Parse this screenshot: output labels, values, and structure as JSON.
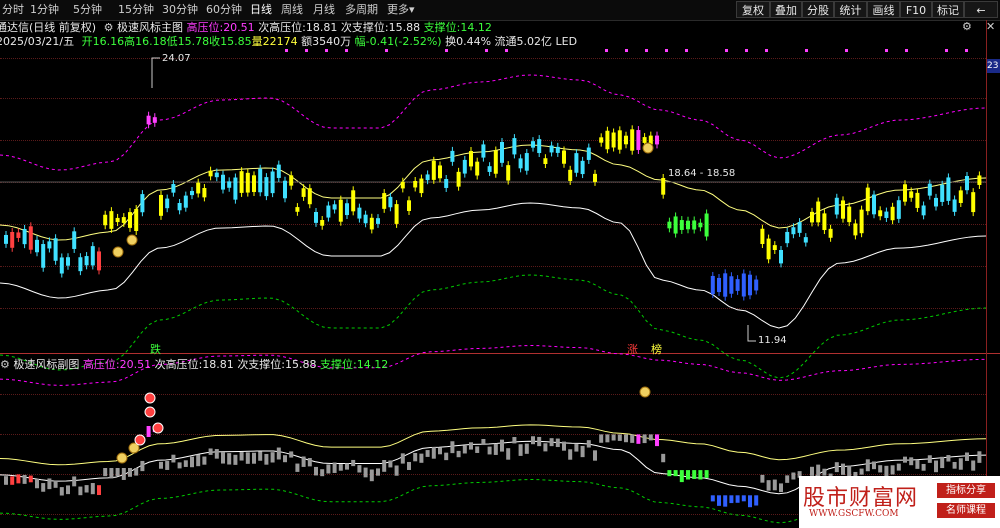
{
  "toolbar": {
    "timeframes": [
      "分时",
      "1分钟",
      "5分钟",
      "15分钟",
      "30分钟",
      "60分钟",
      "日线",
      "周线",
      "月线",
      "多周期",
      "更多"
    ],
    "active_timeframe": "日线",
    "right_buttons": [
      "复权",
      "叠加",
      "分股",
      "统计",
      "画线",
      "F10",
      "标记",
      "←"
    ]
  },
  "main_title": {
    "app": "通达信(日线 前复权)",
    "indicator": "极速风标主图",
    "high_pressure_label": "高压位:",
    "high_pressure_value": "20.51",
    "second_pressure_label": "次高压位:",
    "second_pressure_value": "18.81",
    "second_support_label": "次支撑位:",
    "second_support_value": "15.88",
    "support_label": "支撑位:",
    "support_value": "14.12"
  },
  "quote": {
    "date": "2025/03/21/五",
    "open": "开16.16",
    "high": "高16.18",
    "low": "低15.78",
    "close": "收15.85",
    "volume": "量22174",
    "amount": "额3540万",
    "change": "幅-0.41(-2.52%)",
    "turnover": "换0.44%",
    "float": "流通5.02亿",
    "led": "LED"
  },
  "annotations": {
    "high_mark": "24.07",
    "range_mark": "18.64 - 18.58",
    "low_mark": "11.94",
    "label_die": "跌",
    "label_zhang": "涨",
    "label_bang": "榜",
    "axis_price": "23"
  },
  "sub_title": {
    "indicator": "极速风标副图",
    "high_pressure_label": "高压位:",
    "high_pressure_value": "20.51",
    "second_pressure_label": "次高压位:",
    "second_pressure_value": "18.81",
    "second_support_label": "次支撑位:",
    "second_support_value": "15.88",
    "support_label": "支撑位:",
    "support_value": "14.12"
  },
  "watermark": {
    "main": "股市财富网",
    "url": "WWW.GSCFW.COM",
    "badge1": "指标分享",
    "badge2": "名师课程"
  },
  "colors": {
    "up_candle": "#ffff00",
    "down_candle": "#40e0ff",
    "band_outer": "#ff00ff",
    "band_mid": "#ffff80",
    "band_inner": "#ffffff",
    "band_low": "#00cc00"
  }
}
